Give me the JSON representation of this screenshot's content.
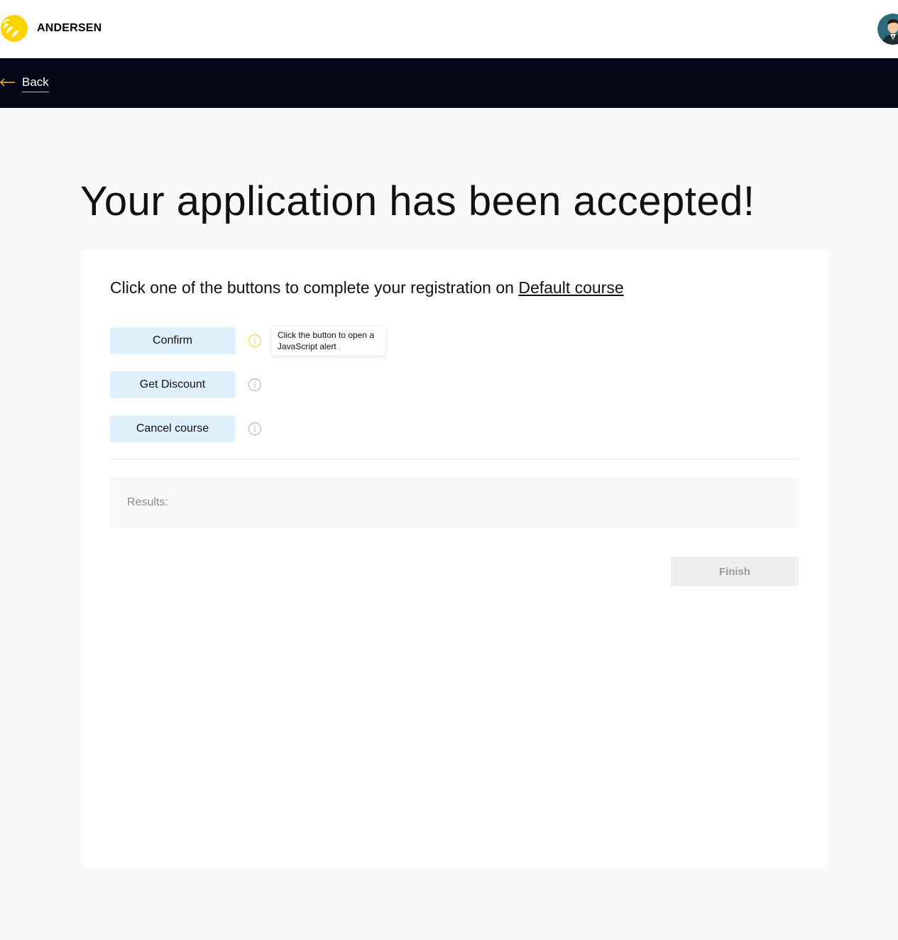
{
  "header": {
    "brand": "ANDERSEN",
    "logo_icon": "andersen-logo-icon",
    "avatar_icon": "user-avatar-icon"
  },
  "nav": {
    "back_label": "Back",
    "back_icon": "arrow-left-icon"
  },
  "page": {
    "title": "Your application has been accepted!"
  },
  "card": {
    "subtitle_prefix": "Click one of the buttons to complete your registration on",
    "course_link": "Default course",
    "buttons": [
      {
        "label": "Confirm",
        "info_icon": "info-icon",
        "active": true
      },
      {
        "label": "Get Discount",
        "info_icon": "info-icon",
        "active": false
      },
      {
        "label": "Cancel course",
        "info_icon": "info-icon",
        "active": false
      }
    ],
    "tooltip": "Click the button to open a JavaScript alert",
    "results_label": "Results:",
    "finish_label": "Finish"
  },
  "colors": {
    "accent_yellow": "#f5c400",
    "navbar_bg": "#020616",
    "button_bg": "#ddf0fc",
    "page_bg": "#f9f9f9"
  }
}
